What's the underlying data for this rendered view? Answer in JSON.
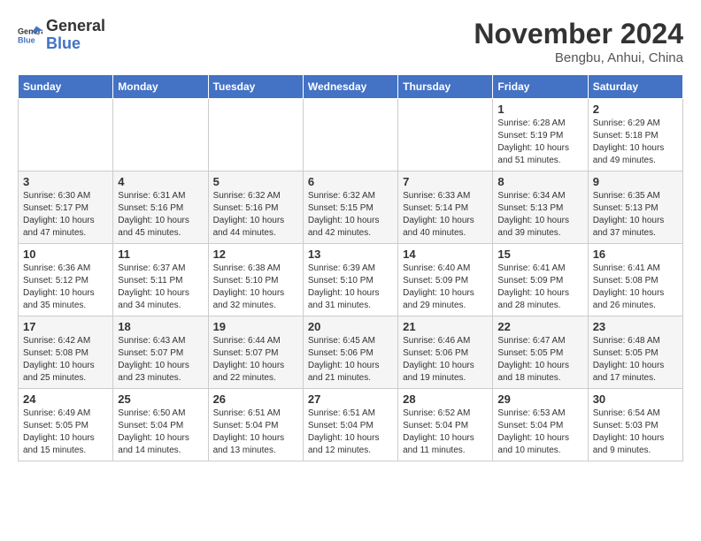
{
  "logo": {
    "line1": "General",
    "line2": "Blue"
  },
  "title": "November 2024",
  "location": "Bengbu, Anhui, China",
  "weekdays": [
    "Sunday",
    "Monday",
    "Tuesday",
    "Wednesday",
    "Thursday",
    "Friday",
    "Saturday"
  ],
  "weeks": [
    [
      {
        "day": "",
        "info": ""
      },
      {
        "day": "",
        "info": ""
      },
      {
        "day": "",
        "info": ""
      },
      {
        "day": "",
        "info": ""
      },
      {
        "day": "",
        "info": ""
      },
      {
        "day": "1",
        "info": "Sunrise: 6:28 AM\nSunset: 5:19 PM\nDaylight: 10 hours\nand 51 minutes."
      },
      {
        "day": "2",
        "info": "Sunrise: 6:29 AM\nSunset: 5:18 PM\nDaylight: 10 hours\nand 49 minutes."
      }
    ],
    [
      {
        "day": "3",
        "info": "Sunrise: 6:30 AM\nSunset: 5:17 PM\nDaylight: 10 hours\nand 47 minutes."
      },
      {
        "day": "4",
        "info": "Sunrise: 6:31 AM\nSunset: 5:16 PM\nDaylight: 10 hours\nand 45 minutes."
      },
      {
        "day": "5",
        "info": "Sunrise: 6:32 AM\nSunset: 5:16 PM\nDaylight: 10 hours\nand 44 minutes."
      },
      {
        "day": "6",
        "info": "Sunrise: 6:32 AM\nSunset: 5:15 PM\nDaylight: 10 hours\nand 42 minutes."
      },
      {
        "day": "7",
        "info": "Sunrise: 6:33 AM\nSunset: 5:14 PM\nDaylight: 10 hours\nand 40 minutes."
      },
      {
        "day": "8",
        "info": "Sunrise: 6:34 AM\nSunset: 5:13 PM\nDaylight: 10 hours\nand 39 minutes."
      },
      {
        "day": "9",
        "info": "Sunrise: 6:35 AM\nSunset: 5:13 PM\nDaylight: 10 hours\nand 37 minutes."
      }
    ],
    [
      {
        "day": "10",
        "info": "Sunrise: 6:36 AM\nSunset: 5:12 PM\nDaylight: 10 hours\nand 35 minutes."
      },
      {
        "day": "11",
        "info": "Sunrise: 6:37 AM\nSunset: 5:11 PM\nDaylight: 10 hours\nand 34 minutes."
      },
      {
        "day": "12",
        "info": "Sunrise: 6:38 AM\nSunset: 5:10 PM\nDaylight: 10 hours\nand 32 minutes."
      },
      {
        "day": "13",
        "info": "Sunrise: 6:39 AM\nSunset: 5:10 PM\nDaylight: 10 hours\nand 31 minutes."
      },
      {
        "day": "14",
        "info": "Sunrise: 6:40 AM\nSunset: 5:09 PM\nDaylight: 10 hours\nand 29 minutes."
      },
      {
        "day": "15",
        "info": "Sunrise: 6:41 AM\nSunset: 5:09 PM\nDaylight: 10 hours\nand 28 minutes."
      },
      {
        "day": "16",
        "info": "Sunrise: 6:41 AM\nSunset: 5:08 PM\nDaylight: 10 hours\nand 26 minutes."
      }
    ],
    [
      {
        "day": "17",
        "info": "Sunrise: 6:42 AM\nSunset: 5:08 PM\nDaylight: 10 hours\nand 25 minutes."
      },
      {
        "day": "18",
        "info": "Sunrise: 6:43 AM\nSunset: 5:07 PM\nDaylight: 10 hours\nand 23 minutes."
      },
      {
        "day": "19",
        "info": "Sunrise: 6:44 AM\nSunset: 5:07 PM\nDaylight: 10 hours\nand 22 minutes."
      },
      {
        "day": "20",
        "info": "Sunrise: 6:45 AM\nSunset: 5:06 PM\nDaylight: 10 hours\nand 21 minutes."
      },
      {
        "day": "21",
        "info": "Sunrise: 6:46 AM\nSunset: 5:06 PM\nDaylight: 10 hours\nand 19 minutes."
      },
      {
        "day": "22",
        "info": "Sunrise: 6:47 AM\nSunset: 5:05 PM\nDaylight: 10 hours\nand 18 minutes."
      },
      {
        "day": "23",
        "info": "Sunrise: 6:48 AM\nSunset: 5:05 PM\nDaylight: 10 hours\nand 17 minutes."
      }
    ],
    [
      {
        "day": "24",
        "info": "Sunrise: 6:49 AM\nSunset: 5:05 PM\nDaylight: 10 hours\nand 15 minutes."
      },
      {
        "day": "25",
        "info": "Sunrise: 6:50 AM\nSunset: 5:04 PM\nDaylight: 10 hours\nand 14 minutes."
      },
      {
        "day": "26",
        "info": "Sunrise: 6:51 AM\nSunset: 5:04 PM\nDaylight: 10 hours\nand 13 minutes."
      },
      {
        "day": "27",
        "info": "Sunrise: 6:51 AM\nSunset: 5:04 PM\nDaylight: 10 hours\nand 12 minutes."
      },
      {
        "day": "28",
        "info": "Sunrise: 6:52 AM\nSunset: 5:04 PM\nDaylight: 10 hours\nand 11 minutes."
      },
      {
        "day": "29",
        "info": "Sunrise: 6:53 AM\nSunset: 5:04 PM\nDaylight: 10 hours\nand 10 minutes."
      },
      {
        "day": "30",
        "info": "Sunrise: 6:54 AM\nSunset: 5:03 PM\nDaylight: 10 hours\nand 9 minutes."
      }
    ]
  ]
}
